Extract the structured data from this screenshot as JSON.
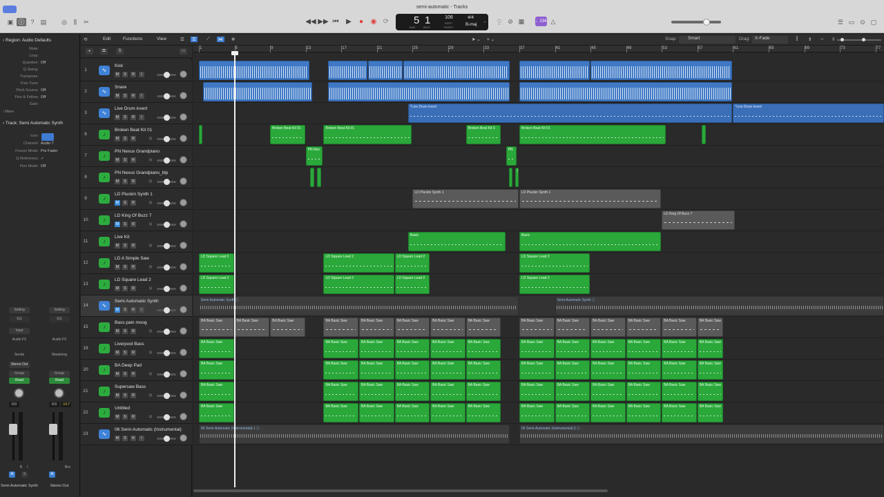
{
  "window": {
    "title": "semi-automatic - Tracks"
  },
  "lcd": {
    "bar": "5",
    "beat": "1",
    "bar_label": "BAR",
    "beat_label": "BEAT",
    "tempo": "106",
    "tempo_mode": "KEEP",
    "tempo_label": "TEMPO",
    "signature": "4/4",
    "key": "B♭maj"
  },
  "badge": {
    "count": "♩234"
  },
  "inspector": {
    "region_header": "Region: Audio Defaults",
    "region_rows": [
      {
        "k": "Mute:",
        "v": ""
      },
      {
        "k": "Loop:",
        "v": ""
      },
      {
        "k": "Quantize:",
        "v": "Off"
      },
      {
        "k": "Q-Swing:",
        "v": ""
      },
      {
        "k": "Transpose:",
        "v": ""
      },
      {
        "k": "Fine Tune:",
        "v": ""
      },
      {
        "k": "Pitch Source:",
        "v": "Off"
      },
      {
        "k": "Flex & Follow:",
        "v": "Off"
      },
      {
        "k": "Gain:",
        "v": ""
      }
    ],
    "more_label": "More",
    "track_header": "Track: Semi Automatic Synth",
    "track_rows": [
      {
        "k": "Icon:",
        "v": ""
      },
      {
        "k": "Channel:",
        "v": "Audio 7"
      },
      {
        "k": "Freeze Mode:",
        "v": "Pre Fader"
      },
      {
        "k": "Q-Reference:",
        "v": "✓"
      },
      {
        "k": "Flex Mode:",
        "v": "Off"
      }
    ],
    "strips": [
      {
        "setting": "Setting",
        "eq": "EQ",
        "input": "Input",
        "fx": "Audio FX",
        "sends": "Sends",
        "out": "Stereo Out",
        "group": "Group",
        "auto": "Read",
        "val": "0.0",
        "peak": "",
        "name": "Semi Automatic Synth",
        "m": "M",
        "s": "S",
        "r": "R",
        "i": "I"
      },
      {
        "setting": "Setting",
        "eq": "EQ",
        "input": "",
        "fx": "Audio FX",
        "sends": "Mastering",
        "out": "",
        "group": "Group",
        "auto": "Read",
        "val": "0.0",
        "peak": "-14.7",
        "name": "Stereo Out",
        "m": "M",
        "s": "",
        "r": "",
        "i": "Bnc"
      }
    ]
  },
  "toolbar": {
    "edit": "Edit",
    "functions": "Functions",
    "view": "View",
    "snap_label": "Snap:",
    "snap_value": "Smart",
    "drag_label": "Drag:",
    "drag_value": "X-Fade"
  },
  "ruler": [
    "1",
    "5",
    "9",
    "13",
    "17",
    "21",
    "25",
    "29",
    "33",
    "37",
    "41",
    "45",
    "49",
    "53",
    "57",
    "61",
    "65",
    "69",
    "73",
    "77"
  ],
  "tracks": [
    {
      "num": "1",
      "name": "Kick",
      "type": "audio",
      "icon": "waveform-icon",
      "m_on": false
    },
    {
      "num": "2",
      "name": "Snare",
      "type": "audio",
      "icon": "waveform-icon",
      "m_on": false
    },
    {
      "num": "3",
      "name": "Live Drum invert",
      "type": "audio",
      "icon": "speaker-icon",
      "m_on": false
    },
    {
      "num": "6",
      "name": "Broken Beat Kit 01",
      "type": "midi",
      "icon": "drum-kit-icon",
      "m_on": false
    },
    {
      "num": "7",
      "name": "PN Nexus Grandpiano",
      "type": "midi",
      "icon": "music-note-icon",
      "m_on": false
    },
    {
      "num": "8",
      "name": "PN Nexus Grandpiano_blp",
      "type": "midi",
      "icon": "music-note-icon",
      "m_on": false
    },
    {
      "num": "9",
      "name": "LD Pluckin Synth 1",
      "type": "midi",
      "icon": "music-note-icon",
      "m_on": true
    },
    {
      "num": "10",
      "name": "LD King Of Buzz 7",
      "type": "midi",
      "icon": "music-note-icon",
      "m_on": true
    },
    {
      "num": "11",
      "name": "Live Kit",
      "type": "midi",
      "icon": "music-note-icon",
      "m_on": false
    },
    {
      "num": "12",
      "name": "LD A Simple Saw",
      "type": "midi",
      "icon": "music-note-icon",
      "m_on": false
    },
    {
      "num": "13",
      "name": "LD Square Lead 2",
      "type": "midi",
      "icon": "music-note-icon",
      "m_on": false
    },
    {
      "num": "14",
      "name": "Semi Automatic Synth",
      "type": "audio",
      "icon": "waveform-icon",
      "m_on": true
    },
    {
      "num": "15",
      "name": "Bass pain moog",
      "type": "midi",
      "icon": "keyboard-icon",
      "m_on": false
    },
    {
      "num": "19",
      "name": "Liverpool Bass",
      "type": "midi",
      "icon": "guitar-icon",
      "m_on": false
    },
    {
      "num": "20",
      "name": "BA Deep Pad",
      "type": "midi",
      "icon": "music-note-icon",
      "m_on": false
    },
    {
      "num": "21",
      "name": "Supersaw Bass",
      "type": "midi",
      "icon": "music-note-icon",
      "m_on": false
    },
    {
      "num": "22",
      "name": "Untitled",
      "type": "midi",
      "icon": "music-note-icon",
      "m_on": false
    },
    {
      "num": "23",
      "name": "06 Semi-Automatic (Instrumental)",
      "type": "audio",
      "icon": "waveform-icon",
      "m_on": false
    }
  ],
  "regions": [
    {
      "lane": 0,
      "start": 1,
      "end": 13.5,
      "label": "",
      "kind": "audioblue"
    },
    {
      "lane": 0,
      "start": 15.5,
      "end": 20,
      "label": "",
      "kind": "audioblue"
    },
    {
      "lane": 0,
      "start": 20,
      "end": 24,
      "label": "",
      "kind": "audioblue"
    },
    {
      "lane": 0,
      "start": 24,
      "end": 36,
      "label": "",
      "kind": "audioblue"
    },
    {
      "lane": 0,
      "start": 37,
      "end": 45,
      "label": "",
      "kind": "audioblue"
    },
    {
      "lane": 0,
      "start": 45,
      "end": 61,
      "label": "",
      "kind": "audioblue"
    },
    {
      "lane": 1,
      "start": 1.5,
      "end": 13.8,
      "label": "",
      "kind": "audioblue"
    },
    {
      "lane": 1,
      "start": 15.5,
      "end": 36,
      "label": "",
      "kind": "audioblue"
    },
    {
      "lane": 1,
      "start": 37,
      "end": 61,
      "label": "",
      "kind": "audioblue"
    },
    {
      "lane": 2,
      "start": 24.5,
      "end": 61,
      "label": "*Live Drum invert",
      "kind": "blue"
    },
    {
      "lane": 2,
      "start": 61,
      "end": 78,
      "label": "*Live Drum invert",
      "kind": "blue"
    },
    {
      "lane": 3,
      "start": 1,
      "end": 1.5,
      "label": "",
      "kind": "green"
    },
    {
      "lane": 3,
      "start": 9,
      "end": 13,
      "label": "Broken Beat Kit 01",
      "kind": "green"
    },
    {
      "lane": 3,
      "start": 15,
      "end": 25,
      "label": "Broken Beat Kit 01",
      "kind": "green"
    },
    {
      "lane": 3,
      "start": 31,
      "end": 35,
      "label": "Broken Beat Kit 0",
      "kind": "green"
    },
    {
      "lane": 3,
      "start": 37,
      "end": 53.5,
      "label": "Broken Beat Kit 01",
      "kind": "green"
    },
    {
      "lane": 3,
      "start": 57.5,
      "end": 58,
      "label": "",
      "kind": "green"
    },
    {
      "lane": 4,
      "start": 13,
      "end": 15,
      "label": "PN Nex",
      "kind": "green"
    },
    {
      "lane": 4,
      "start": 35.5,
      "end": 36.8,
      "label": "PN",
      "kind": "green"
    },
    {
      "lane": 5,
      "start": 13.5,
      "end": 14,
      "label": "",
      "kind": "green"
    },
    {
      "lane": 5,
      "start": 14.3,
      "end": 14.8,
      "label": "",
      "kind": "green"
    },
    {
      "lane": 5,
      "start": 35.8,
      "end": 36.3,
      "label": "",
      "kind": "green"
    },
    {
      "lane": 5,
      "start": 36.5,
      "end": 37,
      "label": "0",
      "kind": "green"
    },
    {
      "lane": 6,
      "start": 25,
      "end": 37,
      "label": "LD Pluckin Synth 1",
      "kind": "gray"
    },
    {
      "lane": 6,
      "start": 37,
      "end": 53,
      "label": "LD Pluckin Synth 1",
      "kind": "gray"
    },
    {
      "lane": 7,
      "start": 53,
      "end": 61.3,
      "label": "LD King Of Buzz 7",
      "kind": "gray"
    },
    {
      "lane": 8,
      "start": 24.5,
      "end": 35.5,
      "label": "Basic",
      "kind": "green"
    },
    {
      "lane": 8,
      "start": 37,
      "end": 53,
      "label": "Basic",
      "kind": "green"
    },
    {
      "lane": 9,
      "start": 1,
      "end": 5,
      "label": "LD Square Lead 2",
      "kind": "green"
    },
    {
      "lane": 9,
      "start": 15,
      "end": 23,
      "label": "LD Square Lead 2",
      "kind": "green"
    },
    {
      "lane": 9,
      "start": 23,
      "end": 27,
      "label": "LD Square Lead 2",
      "kind": "green"
    },
    {
      "lane": 9,
      "start": 37,
      "end": 45,
      "label": "LD Square Lead 2",
      "kind": "green"
    },
    {
      "lane": 10,
      "start": 1,
      "end": 5,
      "label": "LD Square Lead 2",
      "kind": "green"
    },
    {
      "lane": 10,
      "start": 15,
      "end": 23,
      "label": "LD Square Lead 2",
      "kind": "green"
    },
    {
      "lane": 10,
      "start": 23,
      "end": 27,
      "label": "LD Square Lead 2",
      "kind": "green"
    },
    {
      "lane": 10,
      "start": 37,
      "end": 45,
      "label": "LD Square Lead 2",
      "kind": "green"
    },
    {
      "lane": 11,
      "start": 1,
      "end": 37,
      "label": "Semi Automatic Synth ⓘ",
      "kind": "dark"
    },
    {
      "lane": 11,
      "start": 41,
      "end": 78,
      "label": "Semi Automatic Synth ⓘ",
      "kind": "dark"
    },
    {
      "lane": 12,
      "start": 1,
      "end": 5,
      "label": "BA Basic Saw",
      "kind": "gray"
    },
    {
      "lane": 12,
      "start": 5,
      "end": 9,
      "label": "BA Basic Saw",
      "kind": "gray"
    },
    {
      "lane": 12,
      "start": 9,
      "end": 13,
      "label": "BA Basic Saw",
      "kind": "gray"
    },
    {
      "lane": 12,
      "start": 15,
      "end": 19,
      "label": "BA Basic Saw",
      "kind": "gray"
    },
    {
      "lane": 12,
      "start": 19,
      "end": 23,
      "label": "BA Basic Saw",
      "kind": "gray"
    },
    {
      "lane": 12,
      "start": 23,
      "end": 27,
      "label": "BA Basic Saw",
      "kind": "gray"
    },
    {
      "lane": 12,
      "start": 27,
      "end": 31,
      "label": "BA Basic Saw",
      "kind": "gray"
    },
    {
      "lane": 12,
      "start": 31,
      "end": 35,
      "label": "BA Basic Saw",
      "kind": "gray"
    },
    {
      "lane": 12,
      "start": 37,
      "end": 41,
      "label": "BA Basic Saw",
      "kind": "gray"
    },
    {
      "lane": 12,
      "start": 41,
      "end": 45,
      "label": "BA Basic Saw",
      "kind": "gray"
    },
    {
      "lane": 12,
      "start": 45,
      "end": 49,
      "label": "BA Basic Saw",
      "kind": "gray"
    },
    {
      "lane": 12,
      "start": 49,
      "end": 53,
      "label": "BA Basic Saw",
      "kind": "gray"
    },
    {
      "lane": 12,
      "start": 53,
      "end": 57,
      "label": "BA Basic Saw",
      "kind": "gray"
    },
    {
      "lane": 12,
      "start": 57,
      "end": 60,
      "label": "BA Basic Saw",
      "kind": "gray"
    },
    {
      "lane": 13,
      "start": 1,
      "end": 5,
      "label": "BA Basic Saw",
      "kind": "green"
    },
    {
      "lane": 13,
      "start": 15,
      "end": 19,
      "label": "BA Basic Saw",
      "kind": "green"
    },
    {
      "lane": 13,
      "start": 19,
      "end": 23,
      "label": "BA Basic Saw",
      "kind": "green"
    },
    {
      "lane": 13,
      "start": 23,
      "end": 27,
      "label": "BA Basic Saw",
      "kind": "green"
    },
    {
      "lane": 13,
      "start": 27,
      "end": 31,
      "label": "BA Basic Saw",
      "kind": "green"
    },
    {
      "lane": 13,
      "start": 31,
      "end": 35,
      "label": "BA Basic Saw",
      "kind": "green"
    },
    {
      "lane": 13,
      "start": 37,
      "end": 41,
      "label": "BA Basic Saw",
      "kind": "green"
    },
    {
      "lane": 13,
      "start": 41,
      "end": 45,
      "label": "BA Basic Saw",
      "kind": "green"
    },
    {
      "lane": 13,
      "start": 45,
      "end": 49,
      "label": "BA Basic Saw",
      "kind": "green"
    },
    {
      "lane": 13,
      "start": 49,
      "end": 53,
      "label": "BA Basic Saw",
      "kind": "green"
    },
    {
      "lane": 13,
      "start": 53,
      "end": 57,
      "label": "BA Basic Saw",
      "kind": "green"
    },
    {
      "lane": 13,
      "start": 57,
      "end": 60,
      "label": "BA Basic Saw",
      "kind": "green"
    },
    {
      "lane": 14,
      "start": 1,
      "end": 5,
      "label": "BA Basic Saw",
      "kind": "green"
    },
    {
      "lane": 14,
      "start": 15,
      "end": 19,
      "label": "BA Basic Saw",
      "kind": "green"
    },
    {
      "lane": 14,
      "start": 19,
      "end": 23,
      "label": "BA Basic Saw",
      "kind": "green"
    },
    {
      "lane": 14,
      "start": 23,
      "end": 27,
      "label": "BA Basic Saw",
      "kind": "green"
    },
    {
      "lane": 14,
      "start": 27,
      "end": 31,
      "label": "BA Basic Saw",
      "kind": "green"
    },
    {
      "lane": 14,
      "start": 31,
      "end": 35,
      "label": "BA Basic Saw",
      "kind": "green"
    },
    {
      "lane": 14,
      "start": 37,
      "end": 41,
      "label": "BA Basic Saw",
      "kind": "green"
    },
    {
      "lane": 14,
      "start": 41,
      "end": 45,
      "label": "BA Basic Saw",
      "kind": "green"
    },
    {
      "lane": 14,
      "start": 45,
      "end": 49,
      "label": "BA Basic Saw",
      "kind": "green"
    },
    {
      "lane": 14,
      "start": 49,
      "end": 53,
      "label": "BA Basic Saw",
      "kind": "green"
    },
    {
      "lane": 14,
      "start": 53,
      "end": 57,
      "label": "BA Basic Saw",
      "kind": "green"
    },
    {
      "lane": 14,
      "start": 57,
      "end": 60,
      "label": "BA Basic Saw",
      "kind": "green"
    },
    {
      "lane": 15,
      "start": 1,
      "end": 5,
      "label": "BA Basic Saw",
      "kind": "green"
    },
    {
      "lane": 15,
      "start": 15,
      "end": 19,
      "label": "BA Basic Saw",
      "kind": "green"
    },
    {
      "lane": 15,
      "start": 19,
      "end": 23,
      "label": "BA Basic Saw",
      "kind": "green"
    },
    {
      "lane": 15,
      "start": 23,
      "end": 27,
      "label": "BA Basic Saw",
      "kind": "green"
    },
    {
      "lane": 15,
      "start": 27,
      "end": 31,
      "label": "BA Basic Saw",
      "kind": "green"
    },
    {
      "lane": 15,
      "start": 31,
      "end": 35,
      "label": "BA Basic Saw",
      "kind": "green"
    },
    {
      "lane": 15,
      "start": 37,
      "end": 41,
      "label": "BA Basic Saw",
      "kind": "green"
    },
    {
      "lane": 15,
      "start": 41,
      "end": 45,
      "label": "BA Basic Saw",
      "kind": "green"
    },
    {
      "lane": 15,
      "start": 45,
      "end": 49,
      "label": "BA Basic Saw",
      "kind": "green"
    },
    {
      "lane": 15,
      "start": 49,
      "end": 53,
      "label": "BA Basic Saw",
      "kind": "green"
    },
    {
      "lane": 15,
      "start": 53,
      "end": 57,
      "label": "BA Basic Saw",
      "kind": "green"
    },
    {
      "lane": 15,
      "start": 57,
      "end": 60,
      "label": "BA Basic Saw",
      "kind": "green"
    },
    {
      "lane": 16,
      "start": 1,
      "end": 5,
      "label": "BA Basic Saw",
      "kind": "green"
    },
    {
      "lane": 16,
      "start": 15,
      "end": 19,
      "label": "BA Basic Saw",
      "kind": "green"
    },
    {
      "lane": 16,
      "start": 19,
      "end": 23,
      "label": "BA Basic Saw",
      "kind": "green"
    },
    {
      "lane": 16,
      "start": 23,
      "end": 27,
      "label": "BA Basic Saw",
      "kind": "green"
    },
    {
      "lane": 16,
      "start": 27,
      "end": 31,
      "label": "BA Basic Saw",
      "kind": "green"
    },
    {
      "lane": 16,
      "start": 31,
      "end": 35,
      "label": "BA Basic Saw",
      "kind": "green"
    },
    {
      "lane": 16,
      "start": 37,
      "end": 41,
      "label": "BA Basic Saw",
      "kind": "green"
    },
    {
      "lane": 16,
      "start": 41,
      "end": 45,
      "label": "BA Basic Saw",
      "kind": "green"
    },
    {
      "lane": 16,
      "start": 45,
      "end": 49,
      "label": "BA Basic Saw",
      "kind": "green"
    },
    {
      "lane": 16,
      "start": 49,
      "end": 53,
      "label": "BA Basic Saw",
      "kind": "green"
    },
    {
      "lane": 16,
      "start": 53,
      "end": 57,
      "label": "BA Basic Saw",
      "kind": "green"
    },
    {
      "lane": 16,
      "start": 57,
      "end": 60,
      "label": "BA Basic Saw",
      "kind": "green"
    },
    {
      "lane": 17,
      "start": 1,
      "end": 36,
      "label": "06 Semi-Automatic (Instrumental).1 ⓘ",
      "kind": "dark"
    },
    {
      "lane": 17,
      "start": 37,
      "end": 78,
      "label": "06 Semi-Automatic (Instrumental).3 ⓘ",
      "kind": "dark"
    }
  ],
  "playhead_bar": 5
}
